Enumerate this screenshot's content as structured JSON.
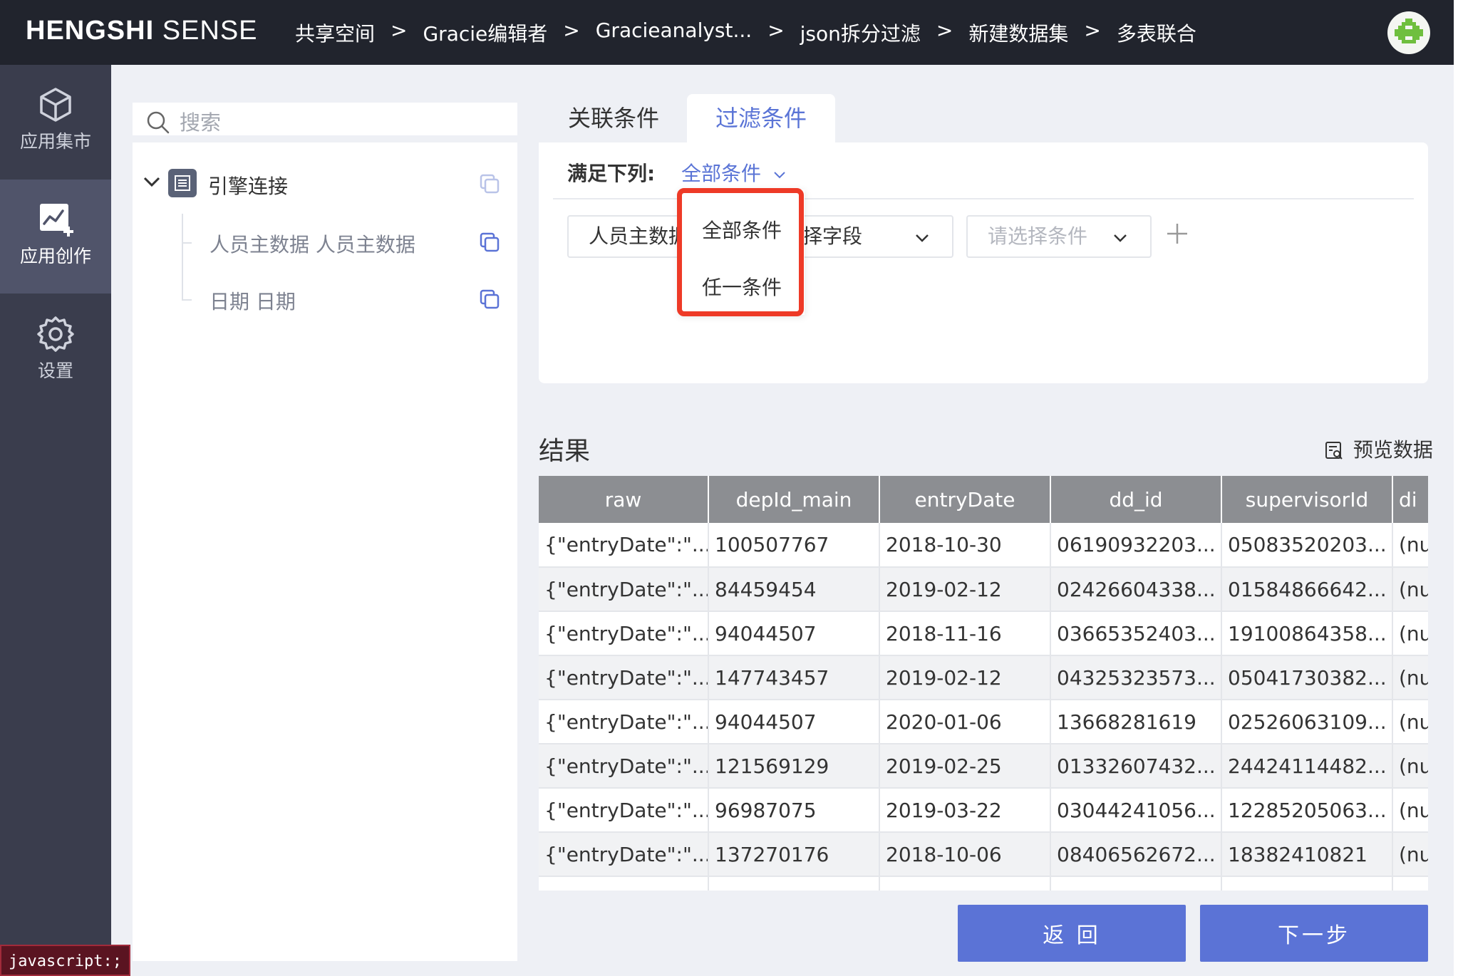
{
  "header": {
    "logo_bold": "HENGSHI",
    "logo_light": "SENSE",
    "breadcrumbs": [
      "共享空间",
      "Gracie编辑者",
      "Gracieanalyst...",
      "json拆分过滤",
      "新建数据集",
      "多表联合"
    ],
    "separator": ">"
  },
  "rail": {
    "items": [
      {
        "label": "应用集市",
        "icon": "cube-icon"
      },
      {
        "label": "应用创作",
        "icon": "chart-create-icon",
        "active": true
      },
      {
        "label": "设置",
        "icon": "gear-icon"
      }
    ]
  },
  "status_tip": "javascript:;",
  "left_panel": {
    "search_placeholder": "搜索",
    "root_label": "引擎连接",
    "children": [
      "人员主数据 人员主数据",
      "日期 日期"
    ]
  },
  "tabs": {
    "join": "关联条件",
    "filter": "过滤条件"
  },
  "filter": {
    "meet_label": "满足下列:",
    "meet_value": "全部条件",
    "field1": "人员主数据",
    "field2": "选择字段",
    "condition_placeholder": "请选择条件",
    "dropdown_options": [
      "全部条件",
      "任一条件"
    ]
  },
  "result": {
    "title": "结果",
    "preview_label": "预览数据",
    "columns": [
      "raw",
      "depId_main",
      "entryDate",
      "dd_id",
      "supervisorId",
      "di"
    ],
    "rows": [
      [
        "{\"entryDate\":\"...",
        "100507767",
        "2018-10-30",
        "06190932203...",
        "05083520203...",
        "(nu"
      ],
      [
        "{\"entryDate\":\"...",
        "84459454",
        "2019-02-12",
        "02426604338...",
        "01584866642...",
        "(nu"
      ],
      [
        "{\"entryDate\":\"...",
        "94044507",
        "2018-11-16",
        "03665352403...",
        "19100864358...",
        "(nu"
      ],
      [
        "{\"entryDate\":\"...",
        "147743457",
        "2019-02-12",
        "04325323573...",
        "05041730382...",
        "(nu"
      ],
      [
        "{\"entryDate\":\"...",
        "94044507",
        "2020-01-06",
        "13668281619",
        "02526063109...",
        "(nu"
      ],
      [
        "{\"entryDate\":\"...",
        "121569129",
        "2019-02-25",
        "01332607432...",
        "24424114482...",
        "(nu"
      ],
      [
        "{\"entryDate\":\"...",
        "96987075",
        "2019-03-22",
        "03044241056...",
        "12285205063...",
        "(nu"
      ],
      [
        "{\"entryDate\":\"...",
        "137270176",
        "2018-10-06",
        "08406562672...",
        "18382410821",
        "(nu"
      ]
    ]
  },
  "footer": {
    "back_label": "返 回",
    "next_label": "下一步"
  },
  "colors": {
    "accent": "#5b73d6",
    "highlight": "#ee3a27",
    "topbar": "#21242d",
    "rail": "#3a3d4d"
  }
}
